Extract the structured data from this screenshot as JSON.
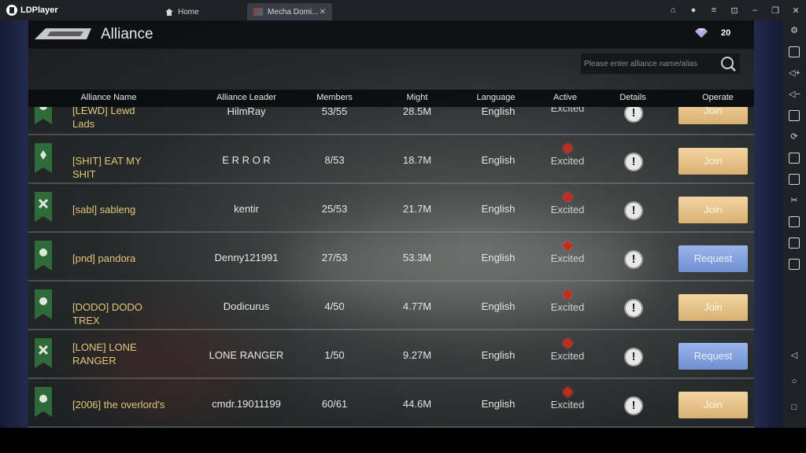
{
  "app": {
    "name": "LDPlayer",
    "tabs": [
      {
        "label": "Home",
        "icon": "home-icon"
      },
      {
        "label": "Mecha Domi...",
        "icon": "game-thumbnail"
      }
    ]
  },
  "window_controls": [
    "gamepad-icon",
    "user-icon",
    "menu-icon",
    "minimize-to-tray-icon",
    "minimize-icon",
    "restore-icon",
    "close-icon"
  ],
  "toolbar_icons": [
    "settings-icon",
    "keyboard-icon",
    "volume-up-icon",
    "volume-down-icon",
    "screenshot-icon",
    "rotate-icon",
    "install-apk-icon",
    "apk-icon",
    "scissors-icon",
    "record-icon",
    "sync-icon",
    "more-icon",
    "back-icon",
    "home-circle-icon",
    "recents-icon"
  ],
  "game": {
    "title": "Alliance",
    "gem_count": "20",
    "search_placeholder": "Please enter alliance name/alias",
    "columns": {
      "name": "Alliance Name",
      "leader": "Alliance Leader",
      "members": "Members",
      "might": "Might",
      "language": "Language",
      "active": "Active",
      "details": "Details",
      "operate": "Operate"
    },
    "rows": [
      {
        "name": "[LEWD] Lewd Lads",
        "leader": "HilmRay",
        "members": "53/55",
        "might": "28.5M",
        "language": "English",
        "active": "Excited",
        "action": "Join",
        "action_type": "join"
      },
      {
        "name": "[SHIT] EAT MY SHIT",
        "leader": "E R R O R",
        "members": "8/53",
        "might": "18.7M",
        "language": "English",
        "active": "Excited",
        "action": "Join",
        "action_type": "join"
      },
      {
        "name": "[sabl] sableng",
        "leader": "kentir",
        "members": "25/53",
        "might": "21.7M",
        "language": "English",
        "active": "Excited",
        "action": "Join",
        "action_type": "join"
      },
      {
        "name": "[pnd] pandora",
        "leader": "Denny121991",
        "members": "27/53",
        "might": "53.3M",
        "language": "English",
        "active": "Excited",
        "action": "Request",
        "action_type": "request"
      },
      {
        "name": "[DODO] DODO TREX",
        "leader": "Dodicurus",
        "members": "4/50",
        "might": "4.77M",
        "language": "English",
        "active": "Excited",
        "action": "Join",
        "action_type": "join"
      },
      {
        "name": "[LONE] LONE RANGER",
        "leader": "LONE RANGER",
        "members": "1/50",
        "might": "9.27M",
        "language": "English",
        "active": "Excited",
        "action": "Request",
        "action_type": "request"
      },
      {
        "name": "[2006] the overlord's",
        "leader": "cmdr.19011199",
        "members": "60/61",
        "might": "44.6M",
        "language": "English",
        "active": "Excited",
        "action": "Join",
        "action_type": "join"
      }
    ]
  }
}
